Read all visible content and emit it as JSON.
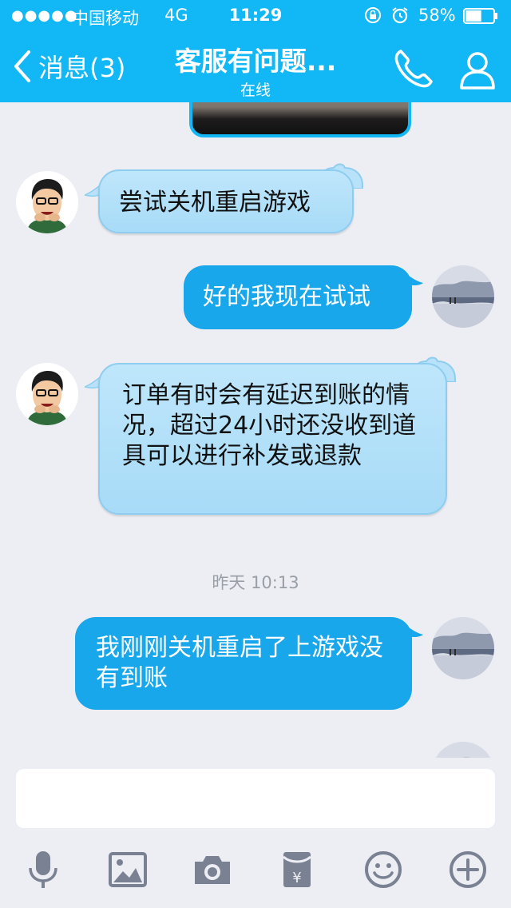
{
  "status_bar": {
    "signal_dots": "●●●●●",
    "carrier": "中国移动",
    "network": "4G",
    "time": "11:29",
    "battery": "58%",
    "battery_level": 0.58
  },
  "header": {
    "back_label": "消息(3)",
    "title": "客服有问题...",
    "subtitle": "在线"
  },
  "messages": [
    {
      "direction": "incoming",
      "text": "尝试关机重启游戏"
    },
    {
      "direction": "outgoing",
      "text": "好的我现在试试"
    },
    {
      "direction": "incoming",
      "text": "订单有时会有延迟到账的情况，超过24小时还没收到道具可以进行补发或退款"
    },
    {
      "direction": "outgoing",
      "text": "我刚刚关机重启了上游戏没有到账"
    }
  ],
  "timestamp": "昨天 10:13",
  "input": {
    "value": "",
    "placeholder": ""
  },
  "toolbar": [
    "microphone-icon",
    "image-icon",
    "camera-icon",
    "red-packet-icon",
    "emoji-icon",
    "plus-icon"
  ],
  "colors": {
    "accent": "#12b7f5",
    "outgoing_bubble": "#18a7ea",
    "incoming_bubble": "#bfe6fb",
    "background": "#eceef3"
  }
}
